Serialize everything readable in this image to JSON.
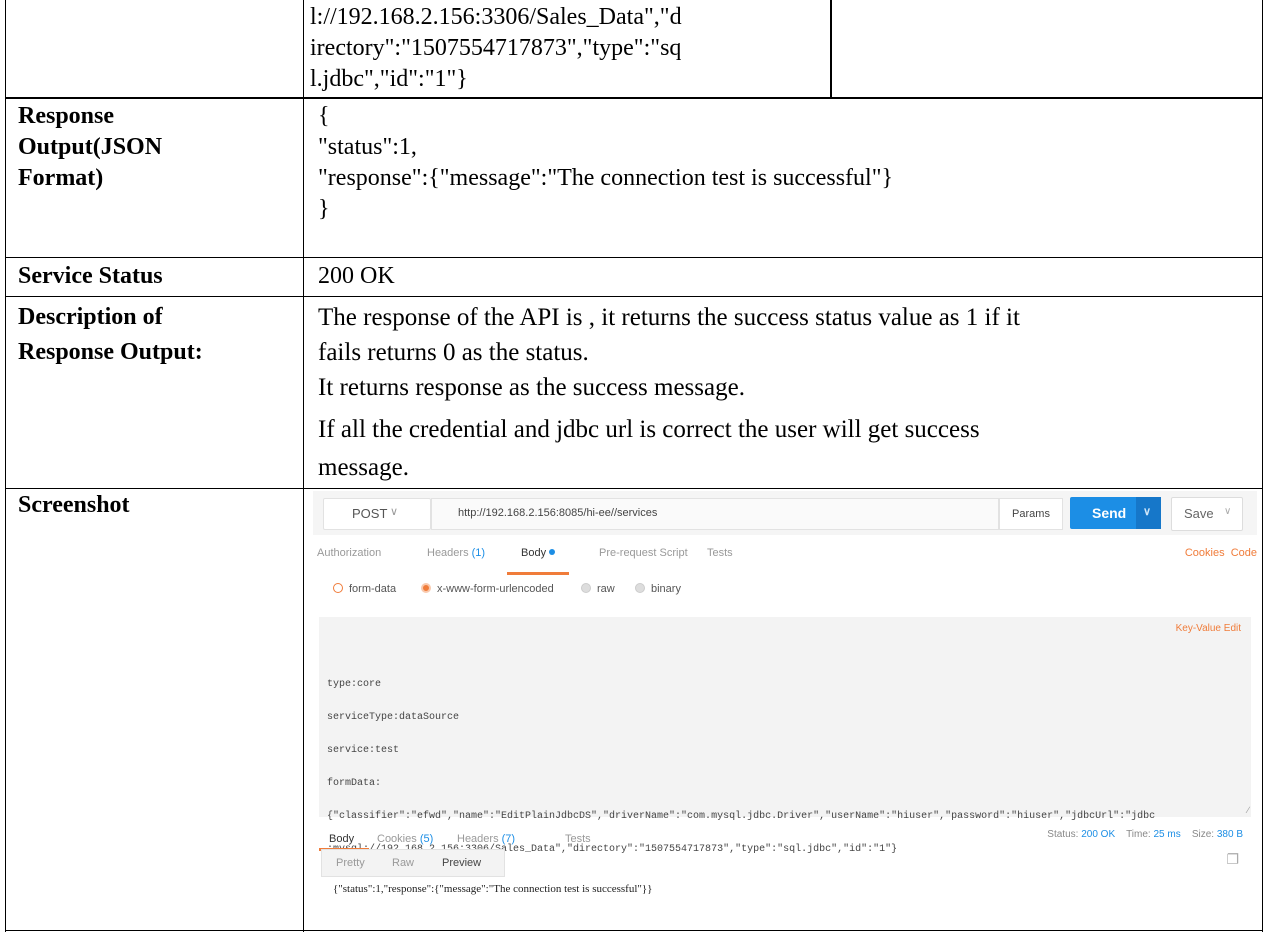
{
  "table": {
    "request_cont": [
      "l://192.168.2.156:3306/Sales_Data\",\"d",
      "irectory\":\"1507554717873\",\"type\":\"sq",
      "l.jdbc\",\"id\":\"1\"}"
    ],
    "response_output_label": [
      "Response",
      "Output(JSON",
      "Format)"
    ],
    "response_output_lines": [
      "{",
      "\"status\":1,",
      "\"response\":{\"message\":\"The connection test is successful\"}",
      "}"
    ],
    "service_status_label": "Service Status",
    "service_status_value": "200 OK",
    "description_label": [
      "Description of",
      "Response Output:"
    ],
    "description_lines": [
      "The response of the API is , it returns the success status value as 1 if it",
      "fails returns 0 as the status.",
      "It returns response as the success message.",
      "If all the credential and jdbc url is correct the user will get success",
      "message."
    ],
    "screenshot_label": "Screenshot"
  },
  "screenshot": {
    "method": "POST",
    "url": "http://192.168.2.156:8085/hi-ee//services",
    "params_label": "Params",
    "send_label": "Send",
    "save_label": "Save",
    "tabs": {
      "authorization": "Authorization",
      "headers": "Headers",
      "headers_count": "(1)",
      "body": "Body",
      "pre_request": "Pre-request Script",
      "tests": "Tests"
    },
    "cookies_label": "Cookies",
    "code_label": "Code",
    "body_types": {
      "form_data": "form-data",
      "urlencoded": "x-www-form-urlencoded",
      "raw": "raw",
      "binary": "binary"
    },
    "key_value_edit": "Key-Value Edit",
    "body_lines": [
      "type:core",
      "serviceType:dataSource",
      "service:test",
      "formData:",
      "{\"classifier\":\"efwd\",\"name\":\"EditPlainJdbcDS\",\"driverName\":\"com.mysql.jdbc.Driver\",\"userName\":\"hiuser\",\"password\":\"hiuser\",\"jdbcUrl\":\"jdbc",
      ":mysql://192.168.2.156:3306/Sales_Data\",\"directory\":\"1507554717873\",\"type\":\"sql.jdbc\",\"id\":\"1\"}"
    ],
    "response_tabs": {
      "body": "Body",
      "cookies": "Cookies",
      "cookies_count": "(5)",
      "headers": "Headers",
      "headers_count": "(7)",
      "tests": "Tests"
    },
    "status_label": "Status:",
    "status_value": "200 OK",
    "time_label": "Time:",
    "time_value": "25 ms",
    "size_label": "Size:",
    "size_value": "380 B",
    "view_tabs": {
      "pretty": "Pretty",
      "raw": "Raw",
      "preview": "Preview"
    },
    "response_body": "{\"status\":1,\"response\":{\"message\":\"The connection test is successful\"}}"
  }
}
